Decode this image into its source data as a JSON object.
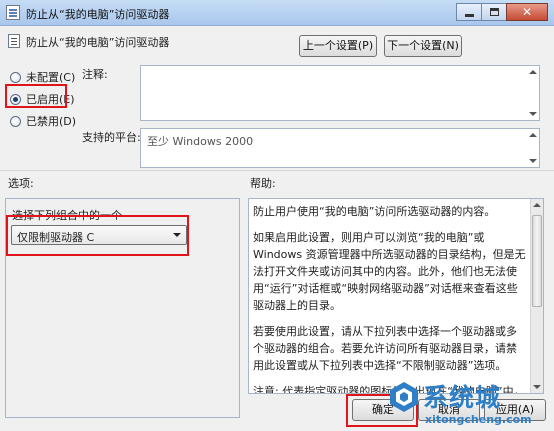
{
  "window": {
    "title": "防止从“我的电脑”访问驱动器"
  },
  "header": {
    "policy_name": "防止从“我的电脑”访问驱动器",
    "prev_button": "上一个设置(P)",
    "next_button": "下一个设置(N)"
  },
  "state": {
    "not_configured": "未配置(C)",
    "enabled": "已启用(E)",
    "disabled": "已禁用(D)",
    "selected": "enabled"
  },
  "fields": {
    "comment_label": "注释:",
    "comment_value": "",
    "platform_label": "支持的平台:",
    "platform_value": "至少 Windows 2000"
  },
  "options": {
    "section_label": "选项:",
    "combo_label": "选择下列组合中的一个",
    "combo_value": "仅限制驱动器 C"
  },
  "help": {
    "section_label": "帮助:",
    "paragraphs": [
      "防止用户使用“我的电脑”访问所选驱动器的内容。",
      "如果启用此设置，则用户可以浏览“我的电脑”或 Windows 资源管理器中所选驱动器的目录结构，但是无法打开文件夹或访问其中的内容。此外，他们也无法使用“运行”对话框或“映射网络驱动器”对话框来查看这些驱动器上的目录。",
      "若要使用此设置，请从下拉列表中选择一个驱动器或多个驱动器的组合。若要允许访问所有驱动器目录，请禁用此设置或从下拉列表中选择“不限制驱动器”选项。",
      "注意: 代表指定驱动器的图标仍会出现在“我的电脑”中，但是如果用户双击这些图标，则会出现一条消息来解释设置防止这一操作"
    ]
  },
  "footer": {
    "ok": "确定",
    "cancel": "取消",
    "apply": "应用(A)"
  },
  "watermark": {
    "name": "系统城",
    "url": "xitongcheng.com"
  },
  "colors": {
    "highlight": "#e0141b",
    "watermark": "#2e7fc6",
    "titlebar": "#b7d1f0"
  }
}
